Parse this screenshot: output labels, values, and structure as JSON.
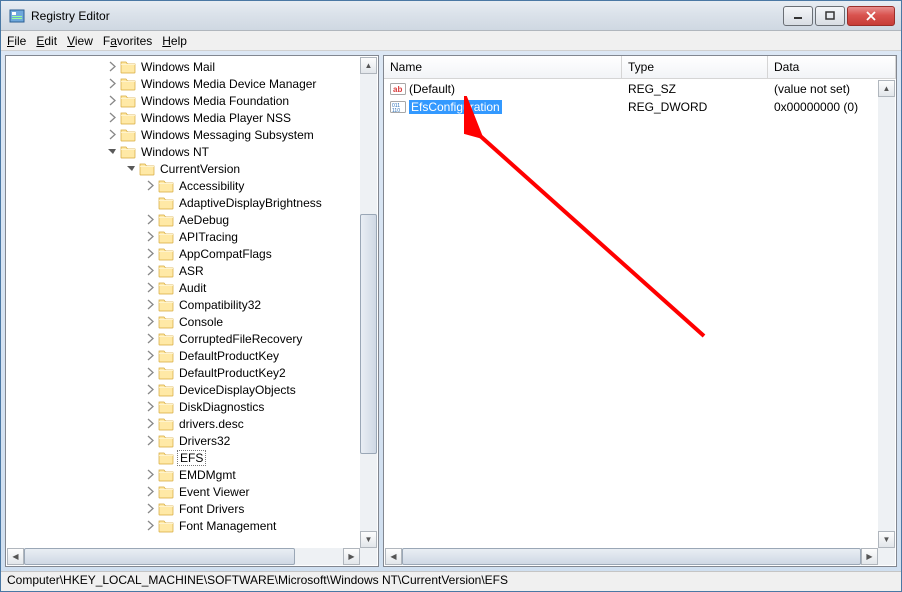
{
  "window": {
    "title": "Registry Editor"
  },
  "menu": {
    "file": "File",
    "edit": "Edit",
    "view": "View",
    "favorites": "Favorites",
    "help": "Help"
  },
  "tree": {
    "top": [
      {
        "l": "Windows Mail",
        "d": 0,
        "e": "c"
      },
      {
        "l": "Windows Media Device Manager",
        "d": 0,
        "e": "c"
      },
      {
        "l": "Windows Media Foundation",
        "d": 0,
        "e": "c"
      },
      {
        "l": "Windows Media Player NSS",
        "d": 0,
        "e": "c"
      },
      {
        "l": "Windows Messaging Subsystem",
        "d": 0,
        "e": "c"
      },
      {
        "l": "Windows NT",
        "d": 0,
        "e": "o"
      },
      {
        "l": "CurrentVersion",
        "d": 1,
        "e": "o"
      },
      {
        "l": "Accessibility",
        "d": 2,
        "e": "c"
      },
      {
        "l": "AdaptiveDisplayBrightness",
        "d": 2,
        "e": "n"
      },
      {
        "l": "AeDebug",
        "d": 2,
        "e": "c"
      },
      {
        "l": "APITracing",
        "d": 2,
        "e": "c"
      },
      {
        "l": "AppCompatFlags",
        "d": 2,
        "e": "c"
      },
      {
        "l": "ASR",
        "d": 2,
        "e": "c"
      },
      {
        "l": "Audit",
        "d": 2,
        "e": "c"
      },
      {
        "l": "Compatibility32",
        "d": 2,
        "e": "c"
      },
      {
        "l": "Console",
        "d": 2,
        "e": "c"
      },
      {
        "l": "CorruptedFileRecovery",
        "d": 2,
        "e": "c"
      },
      {
        "l": "DefaultProductKey",
        "d": 2,
        "e": "c"
      },
      {
        "l": "DefaultProductKey2",
        "d": 2,
        "e": "c"
      },
      {
        "l": "DeviceDisplayObjects",
        "d": 2,
        "e": "c"
      },
      {
        "l": "DiskDiagnostics",
        "d": 2,
        "e": "c"
      },
      {
        "l": "drivers.desc",
        "d": 2,
        "e": "c"
      },
      {
        "l": "Drivers32",
        "d": 2,
        "e": "c"
      },
      {
        "l": "EFS",
        "d": 2,
        "e": "n",
        "sel": true
      },
      {
        "l": "EMDMgmt",
        "d": 2,
        "e": "c"
      },
      {
        "l": "Event Viewer",
        "d": 2,
        "e": "c"
      },
      {
        "l": "Font Drivers",
        "d": 2,
        "e": "c"
      },
      {
        "l": "Font Management",
        "d": 2,
        "e": "c"
      }
    ]
  },
  "list": {
    "cols": {
      "name": "Name",
      "type": "Type",
      "data": "Data"
    },
    "rows": [
      {
        "icon": "str",
        "name": "(Default)",
        "type": "REG_SZ",
        "data": "(value not set)",
        "sel": false
      },
      {
        "icon": "bin",
        "name": "EfsConfiguration",
        "type": "REG_DWORD",
        "data": "0x00000000 (0)",
        "sel": true
      }
    ]
  },
  "status": {
    "path": "Computer\\HKEY_LOCAL_MACHINE\\SOFTWARE\\Microsoft\\Windows NT\\CurrentVersion\\EFS"
  }
}
